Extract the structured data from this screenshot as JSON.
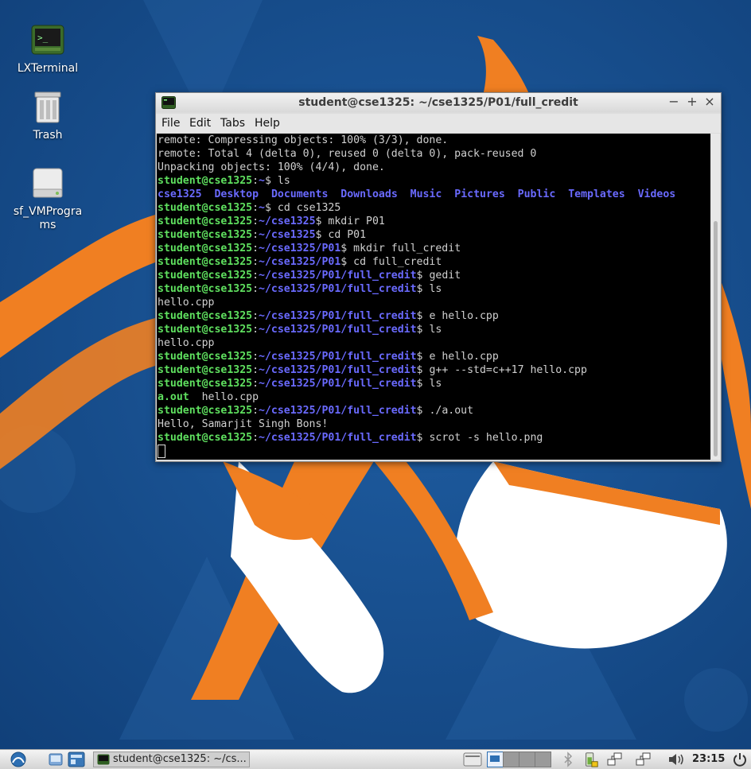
{
  "desktop": {
    "icons": [
      {
        "label": "LXTerminal",
        "icon": "terminal-icon"
      },
      {
        "label": "Trash",
        "icon": "trash-icon"
      },
      {
        "label": "sf_VMPrograms",
        "label_line1": "sf_VMProgra",
        "label_line2": "ms",
        "icon": "drive-icon"
      }
    ]
  },
  "terminal": {
    "title": "student@cse1325: ~/cse1325/P01/full_credit",
    "controls": {
      "minimize": "−",
      "maximize": "+",
      "close": "×"
    },
    "menu": [
      "File",
      "Edit",
      "Tabs",
      "Help"
    ],
    "prompt_user": "student@cse1325",
    "lines": [
      {
        "kind": "out",
        "text": "remote: Compressing objects: 100% (3/3), done."
      },
      {
        "kind": "out",
        "text": "remote: Total 4 (delta 0), reused 0 (delta 0), pack-reused 0"
      },
      {
        "kind": "out",
        "text": "Unpacking objects: 100% (4/4), done."
      },
      {
        "kind": "cmd",
        "path": "~",
        "cmd": " ls"
      },
      {
        "kind": "dirs",
        "items": [
          "cse1325",
          "Desktop",
          "Documents",
          "Downloads",
          "Music",
          "Pictures",
          "Public",
          "Templates",
          "Videos"
        ]
      },
      {
        "kind": "cmd",
        "path": "~",
        "cmd": " cd cse1325"
      },
      {
        "kind": "cmd",
        "path": "~/cse1325",
        "cmd": " mkdir P01"
      },
      {
        "kind": "cmd",
        "path": "~/cse1325",
        "cmd": " cd P01"
      },
      {
        "kind": "cmd",
        "path": "~/cse1325/P01",
        "cmd": " mkdir full_credit"
      },
      {
        "kind": "cmd",
        "path": "~/cse1325/P01",
        "cmd": " cd full_credit"
      },
      {
        "kind": "cmd",
        "path": "~/cse1325/P01/full_credit",
        "cmd": " gedit"
      },
      {
        "kind": "cmd",
        "path": "~/cse1325/P01/full_credit",
        "cmd": " ls"
      },
      {
        "kind": "out",
        "text": "hello.cpp"
      },
      {
        "kind": "cmd",
        "path": "~/cse1325/P01/full_credit",
        "cmd": " e hello.cpp"
      },
      {
        "kind": "cmd",
        "path": "~/cse1325/P01/full_credit",
        "cmd": " ls"
      },
      {
        "kind": "out",
        "text": "hello.cpp"
      },
      {
        "kind": "cmd",
        "path": "~/cse1325/P01/full_credit",
        "cmd": " e hello.cpp"
      },
      {
        "kind": "cmd",
        "path": "~/cse1325/P01/full_credit",
        "cmd": " g++ --std=c++17 hello.cpp"
      },
      {
        "kind": "cmd",
        "path": "~/cse1325/P01/full_credit",
        "cmd": " ls"
      },
      {
        "kind": "files",
        "exe": "a.out",
        "rest": "  hello.cpp"
      },
      {
        "kind": "cmd",
        "path": "~/cse1325/P01/full_credit",
        "cmd": " ./a.out"
      },
      {
        "kind": "out",
        "text": "Hello, Samarjit Singh Bons!"
      },
      {
        "kind": "cmd",
        "path": "~/cse1325/P01/full_credit",
        "cmd": " scrot -s hello.png"
      },
      {
        "kind": "cursor"
      }
    ]
  },
  "taskbar": {
    "task_label": "student@cse1325: ~/cs...",
    "clock": "23:15",
    "icons": [
      "menu-icon",
      "show-desktop-icon",
      "file-manager-icon",
      "pager-icon",
      "bluetooth-icon",
      "battery-icon",
      "network-icon",
      "network-icon-2",
      "volume-icon",
      "power-icon"
    ]
  },
  "colors": {
    "prompt_green": "#5fe05f",
    "path_blue": "#6a6aff",
    "terminal_bg": "#000000",
    "wallpaper_blue": "#1a4f8f",
    "wallpaper_orange": "#f07f22"
  }
}
